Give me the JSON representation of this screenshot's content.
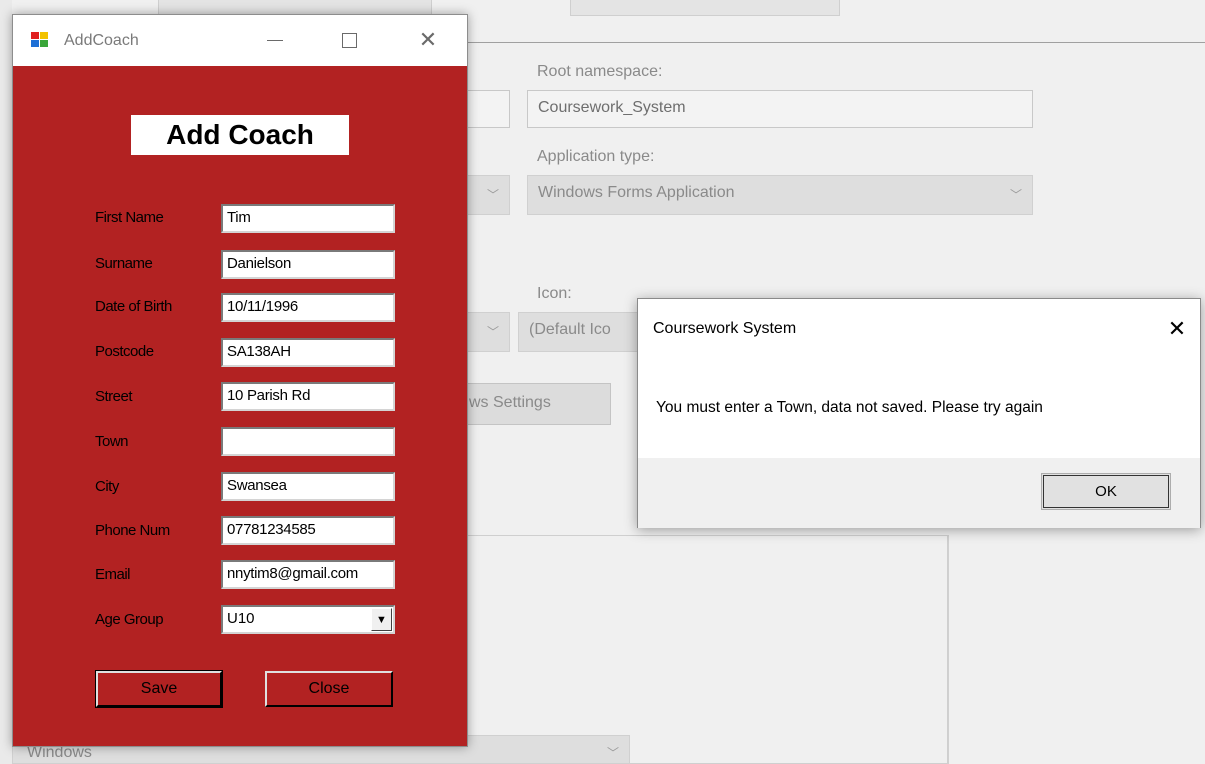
{
  "background": {
    "root_namespace_label": "Root namespace:",
    "root_namespace_value": "Coursework_System",
    "application_type_label": "Application type:",
    "application_type_value": "Windows Forms Application",
    "icon_label": "Icon:",
    "icon_value": "(Default Ico",
    "settings_button": "ws Settings",
    "bottom_combo_value": "Windows"
  },
  "add_coach_window": {
    "title": "AddCoach",
    "heading": "Add Coach",
    "fields": [
      {
        "label": "First Name",
        "value": "Tim"
      },
      {
        "label": "Surname",
        "value": "Danielson"
      },
      {
        "label": "Date of Birth",
        "value": "10/11/1996"
      },
      {
        "label": "Postcode",
        "value": "SA138AH"
      },
      {
        "label": "Street",
        "value": "10 Parish Rd"
      },
      {
        "label": "Town",
        "value": ""
      },
      {
        "label": "City",
        "value": "Swansea"
      },
      {
        "label": "Phone Num",
        "value": "07781234585"
      },
      {
        "label": "Email",
        "value": "nnytim8@gmail.com"
      }
    ],
    "age_group": {
      "label": "Age Group",
      "value": "U10"
    },
    "save_label": "Save",
    "close_label": "Close",
    "colors": {
      "form_background": "#b22222"
    }
  },
  "message_box": {
    "title": "Coursework System",
    "message": "You must enter a Town, data not saved. Please try again",
    "ok_label": "OK"
  }
}
